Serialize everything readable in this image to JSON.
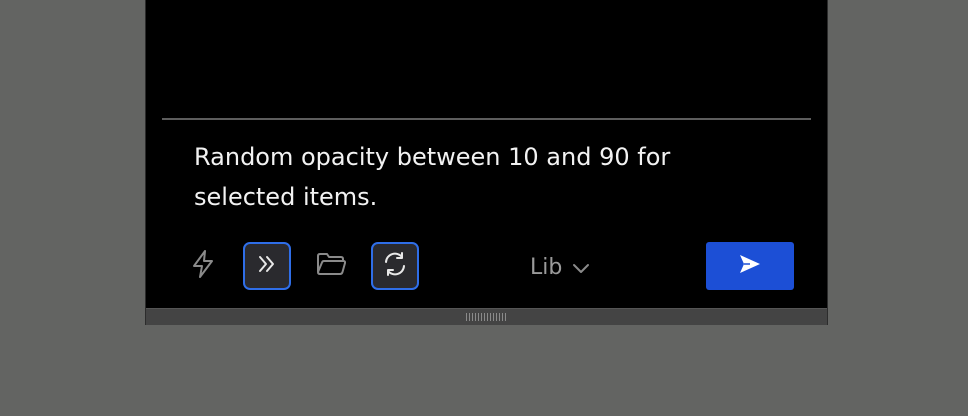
{
  "prompt": {
    "line1": "Random opacity between 10 and 90 for",
    "line2": "selected items."
  },
  "toolbar": {
    "library_label": "Lib",
    "accent_color": "#2f6ee8",
    "send_color": "#1c4fd6",
    "icons": [
      "lightning-icon",
      "double-chevron-right-icon",
      "folder-icon",
      "refresh-icon",
      "chevron-down-icon",
      "send-icon"
    ]
  }
}
